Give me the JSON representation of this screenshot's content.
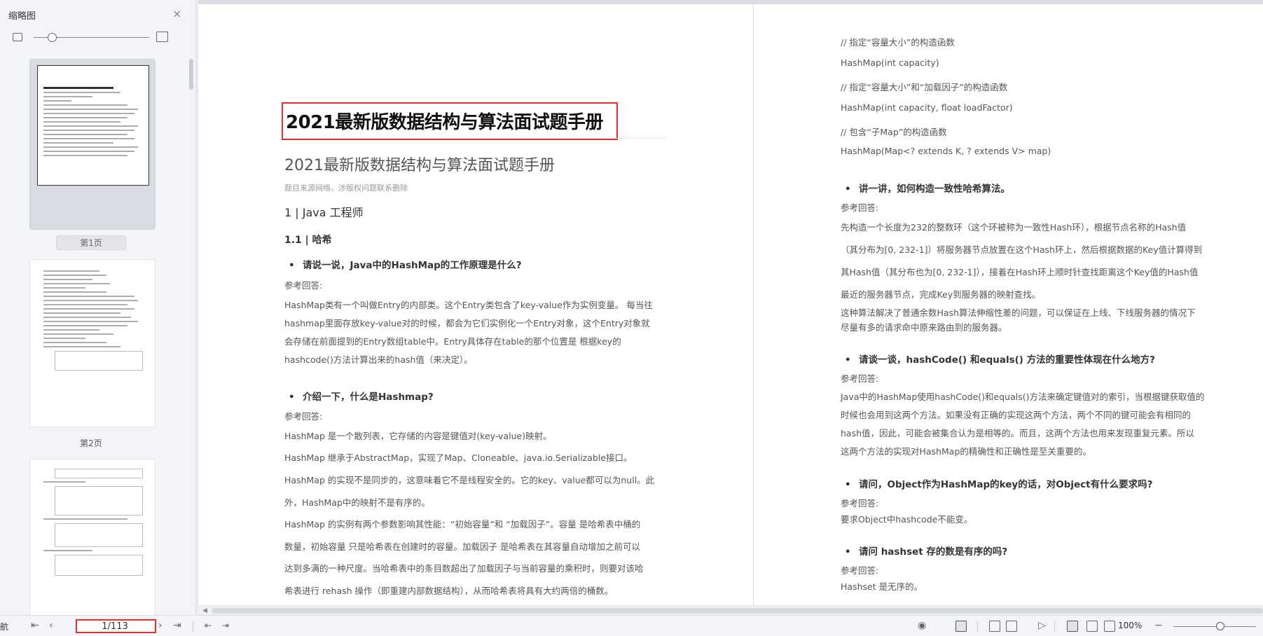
{
  "sidebar": {
    "title": "缩略图",
    "close_icon": "×",
    "pages": [
      {
        "label": "第1页",
        "active": true
      },
      {
        "label": "第2页",
        "active": false
      }
    ]
  },
  "doc": {
    "left": {
      "title_h1": "2021最新版数据结构与算法面试题手册",
      "title_h2": "2021最新版数据结构与算法面试题手册",
      "note": "题目来源网络，涉版权问题联系删除",
      "h3": "1 | Java 工程师",
      "h4": "1.1 | 哈希",
      "q1": "请说一说，Java中的HashMap的工作原理是什么?",
      "q1_label": "参考回答:",
      "q1_lines": [
        "HashMap类有一个叫做Entry的内部类。这个Entry类包含了key-value作为实例变量。 每当往",
        "hashmap里面存放key-value对的时候，都会为它们实例化一个Entry对象，这个Entry对象就",
        "会存储在前面提到的Entry数组table中。Entry具体存在table的那个位置是 根据key的",
        "hashcode()方法计算出来的hash值（来决定）。"
      ],
      "q2": "介绍一下，什么是Hashmap?",
      "q2_label": "参考回答:",
      "q2_p1": "HashMap 是一个散列表，它存储的内容是键值对(key-value)映射。",
      "q2_p2": "HashMap 继承于AbstractMap，实现了Map、Cloneable、java.io.Serializable接口。",
      "q2_p3": [
        "HashMap 的实现不是同步的，这意味着它不是线程安全的。它的key、value都可以为null。此",
        "外，HashMap中的映射不是有序的。"
      ],
      "q2_p4": [
        "HashMap 的实例有两个参数影响其性能：“初始容量”和 “加载因子”。容量 是哈希表中桶的",
        "数量，初始容量 只是哈希表在创建时的容量。加载因子 是哈希表在其容量自动增加之前可以",
        "达到多满的一种尺度。当哈希表中的条目数超出了加载因子与当前容量的乘积时，则要对该哈",
        "希表进行 rehash 操作（即重建内部数据结构），从而哈希表将具有大约两倍的桶数。"
      ]
    },
    "right": {
      "code": [
        "// 指定“容量大小”的构造函数",
        "HashMap(int capacity)",
        "// 指定“容量大小”和“加载因子”的构造函数",
        "HashMap(int capacity, float loadFactor)",
        "// 包含“子Map”的构造函数",
        "HashMap(Map<? extends K, ? extends V> map)"
      ],
      "q3": "讲一讲，如何构造一致性哈希算法。",
      "q3_label": "参考回答:",
      "q3_lines": [
        "先构造一个长度为232的整数环（这个环被称为一致性Hash环），根据节点名称的Hash值",
        "（其分布为[0, 232-1]）将服务器节点放置在这个Hash环上，然后根据数据的Key值计算得到",
        "其Hash值（其分布也为[0, 232-1]），接着在Hash环上顺时针查找距离这个Key值的Hash值",
        "最近的服务器节点，完成Key到服务器的映射查找。"
      ],
      "q3_p2": [
        "这种算法解决了普通余数Hash算法伸缩性差的问题，可以保证在上线、下线服务器的情况下",
        "尽量有多的请求命中原来路由到的服务器。"
      ],
      "q4": "请谈一谈，hashCode() 和equals() 方法的重要性体现在什么地方?",
      "q4_label": "参考回答:",
      "q4_lines": [
        "Java中的HashMap使用hashCode()和equals()方法来确定键值对的索引，当根据键获取值的",
        "时候也会用到这两个方法。如果没有正确的实现这两个方法，两个不同的键可能会有相同的",
        "hash值，因此，可能会被集合认为是相等的。而且，这两个方法也用来发现重复元素。所以",
        "这两个方法的实现对HashMap的精确性和正确性是至关重要的。"
      ],
      "q5": "请问，Object作为HashMap的key的话，对Object有什么要求吗?",
      "q5_label": "参考回答:",
      "q5_text": "要求Object中hashcode不能变。",
      "q6": "请问 hashset 存的数是有序的吗?",
      "q6_label": "参考回答:",
      "q6_text": "Hashset 是无序的。"
    }
  },
  "statusbar": {
    "nav_label": "航",
    "page_value": "1/113",
    "zoom": "100%"
  },
  "icons": [
    "close-icon",
    "image-small-icon",
    "image-large-icon",
    "first-page-icon",
    "prev-page-icon",
    "next-page-icon",
    "last-page-icon",
    "back-icon",
    "forward-icon",
    "eye-icon",
    "single-page-icon",
    "continuous-icon",
    "double-page-icon",
    "play-icon",
    "actual-size-icon",
    "fit-page-icon",
    "fit-width-icon",
    "zoom-out-icon"
  ]
}
